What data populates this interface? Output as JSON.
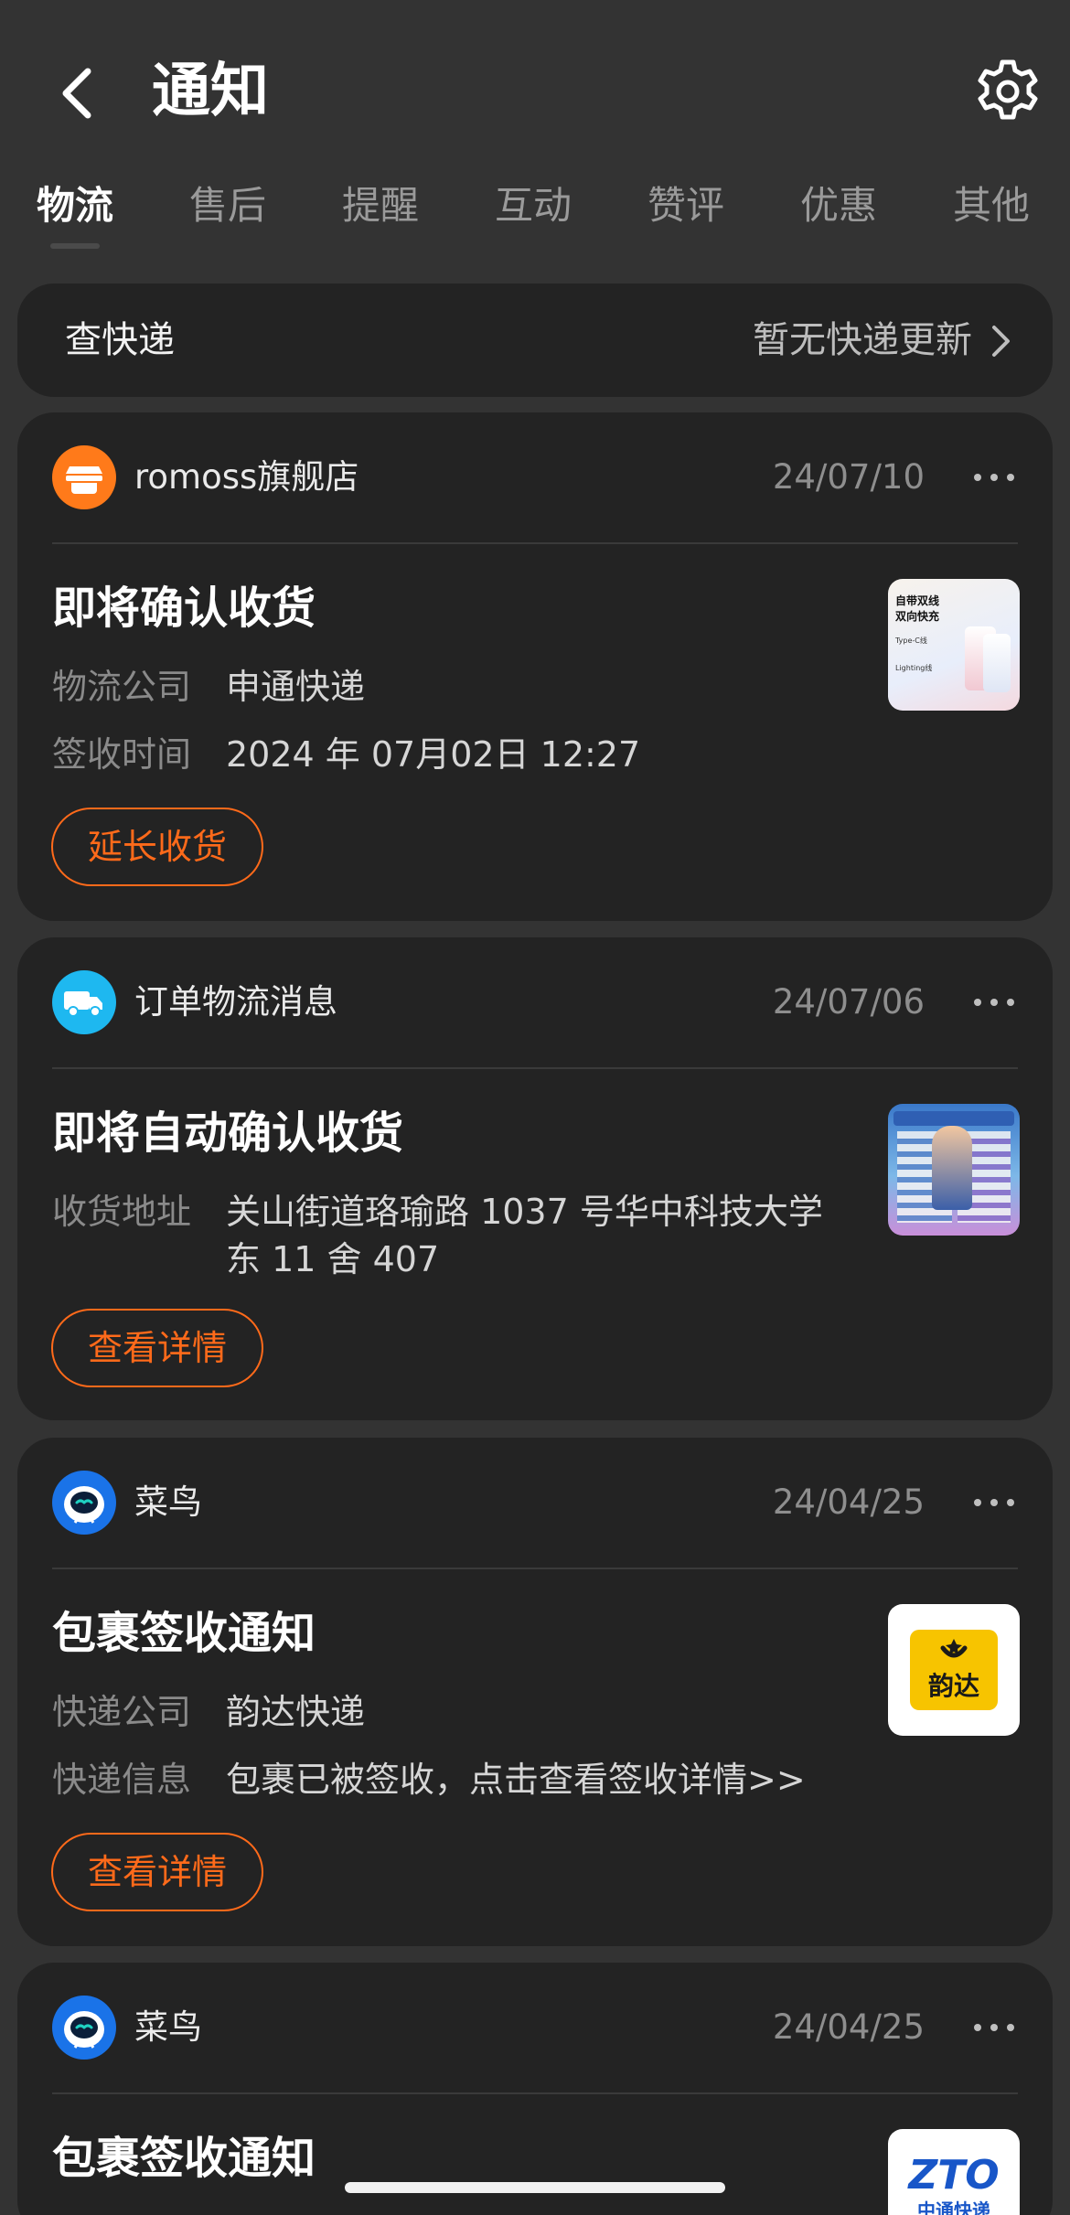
{
  "header": {
    "title": "通知"
  },
  "tabs": [
    {
      "label": "物流",
      "active": true
    },
    {
      "label": "售后"
    },
    {
      "label": "提醒"
    },
    {
      "label": "互动"
    },
    {
      "label": "赞评"
    },
    {
      "label": "优惠"
    },
    {
      "label": "其他"
    }
  ],
  "express": {
    "title": "查快递",
    "status": "暂无快递更新"
  },
  "cards": [
    {
      "shop": "romoss旗舰店",
      "date": "24/07/10",
      "title": "即将确认收货",
      "rows": [
        {
          "k": "物流公司",
          "v": "申通快递"
        },
        {
          "k": "签收时间",
          "v": "2024 年 07月02日 12:27"
        }
      ],
      "button": "延长收货",
      "thumb_text": [
        "自带双线",
        "双向快充",
        "Type-C线",
        "Lighting线"
      ]
    },
    {
      "shop": "订单物流消息",
      "date": "24/07/06",
      "title": "即将自动确认收货",
      "rows": [
        {
          "k": "收货地址",
          "v": "关山街道珞瑜路 1037 号华中科技大学东 11 舍 407"
        }
      ],
      "button": "查看详情"
    },
    {
      "shop": "菜鸟",
      "date": "24/04/25",
      "title": "包裹签收通知",
      "rows": [
        {
          "k": "快递公司",
          "v": "韵达快递"
        },
        {
          "k": "快递信息",
          "v": "包裹已被签收，点击查看签收详情>>"
        }
      ],
      "button": "查看详情",
      "thumb_text": [
        "韵达"
      ]
    },
    {
      "shop": "菜鸟",
      "date": "24/04/25",
      "title": "包裹签收通知",
      "thumb_text": [
        "ZTO",
        "中通快递"
      ]
    }
  ],
  "colors": {
    "background": "#333333",
    "card": "#232323",
    "accent": "#ff6a1a",
    "cainiao": "#1a73e8",
    "truck": "#1eb8f0"
  }
}
